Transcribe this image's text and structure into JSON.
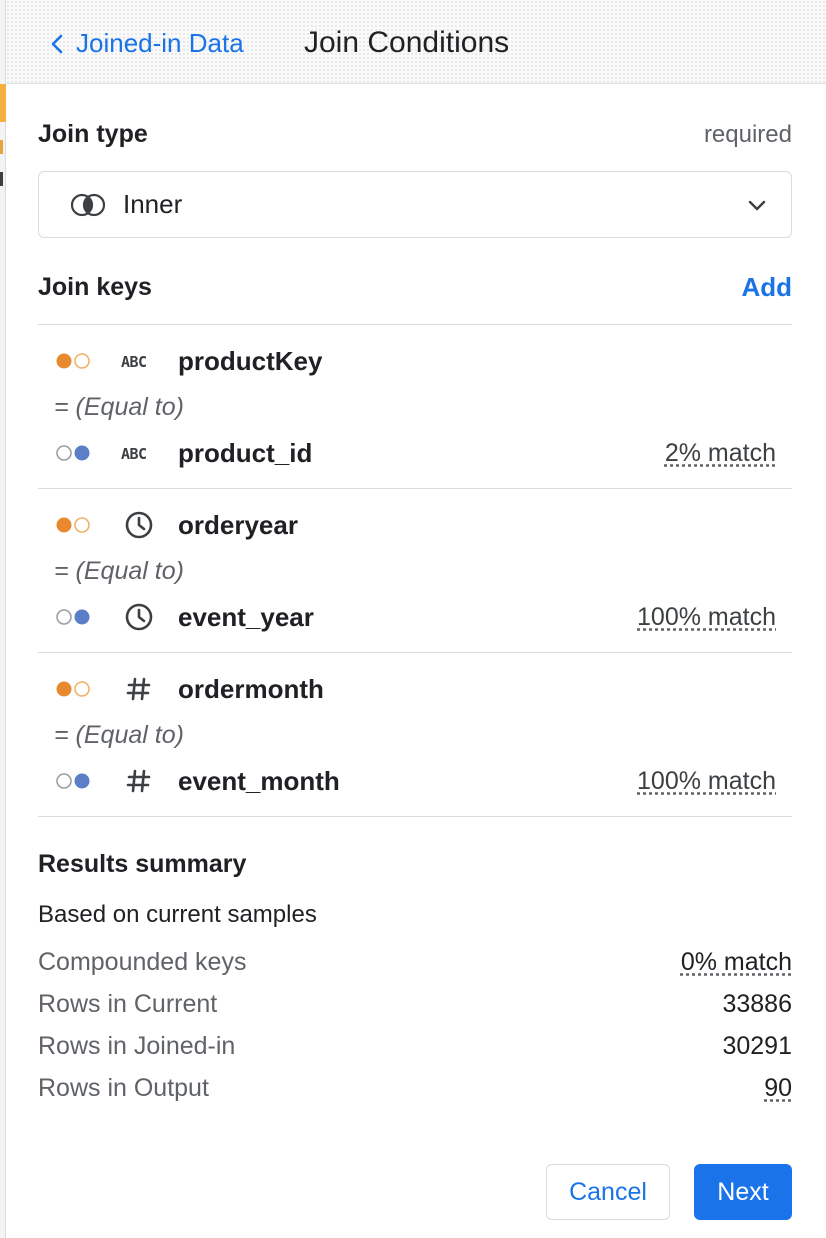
{
  "header": {
    "back_label": "Joined-in Data",
    "title": "Join Conditions"
  },
  "join_type": {
    "label": "Join type",
    "required_label": "required",
    "selected": "Inner",
    "icon": "venn-inner-icon"
  },
  "join_keys": {
    "label": "Join keys",
    "add_label": "Add",
    "items": [
      {
        "left_field": "productKey",
        "left_type_icon": "abc-icon",
        "operator": "= (Equal to)",
        "right_field": "product_id",
        "right_type_icon": "abc-icon",
        "match": "2% match"
      },
      {
        "left_field": "orderyear",
        "left_type_icon": "clock-icon",
        "operator": "= (Equal to)",
        "right_field": "event_year",
        "right_type_icon": "clock-icon",
        "match": "100% match"
      },
      {
        "left_field": "ordermonth",
        "left_type_icon": "hash-icon",
        "operator": "= (Equal to)",
        "right_field": "event_month",
        "right_type_icon": "hash-icon",
        "match": "100% match"
      }
    ]
  },
  "results": {
    "label": "Results summary",
    "based_on": "Based on current samples",
    "rows": [
      {
        "label": "Compounded keys",
        "value": "0% match"
      },
      {
        "label": "Rows in Current",
        "value": "33886"
      },
      {
        "label": "Rows in Joined-in",
        "value": "30291"
      },
      {
        "label": "Rows in Output",
        "value": "90"
      }
    ]
  },
  "actions": {
    "cancel_label": "Cancel",
    "next_label": "Next"
  },
  "colors": {
    "accent_blue": "#1a73e8",
    "current_dot_orange": "#e8892f",
    "joined_dot_blue": "#5b7fc7"
  }
}
